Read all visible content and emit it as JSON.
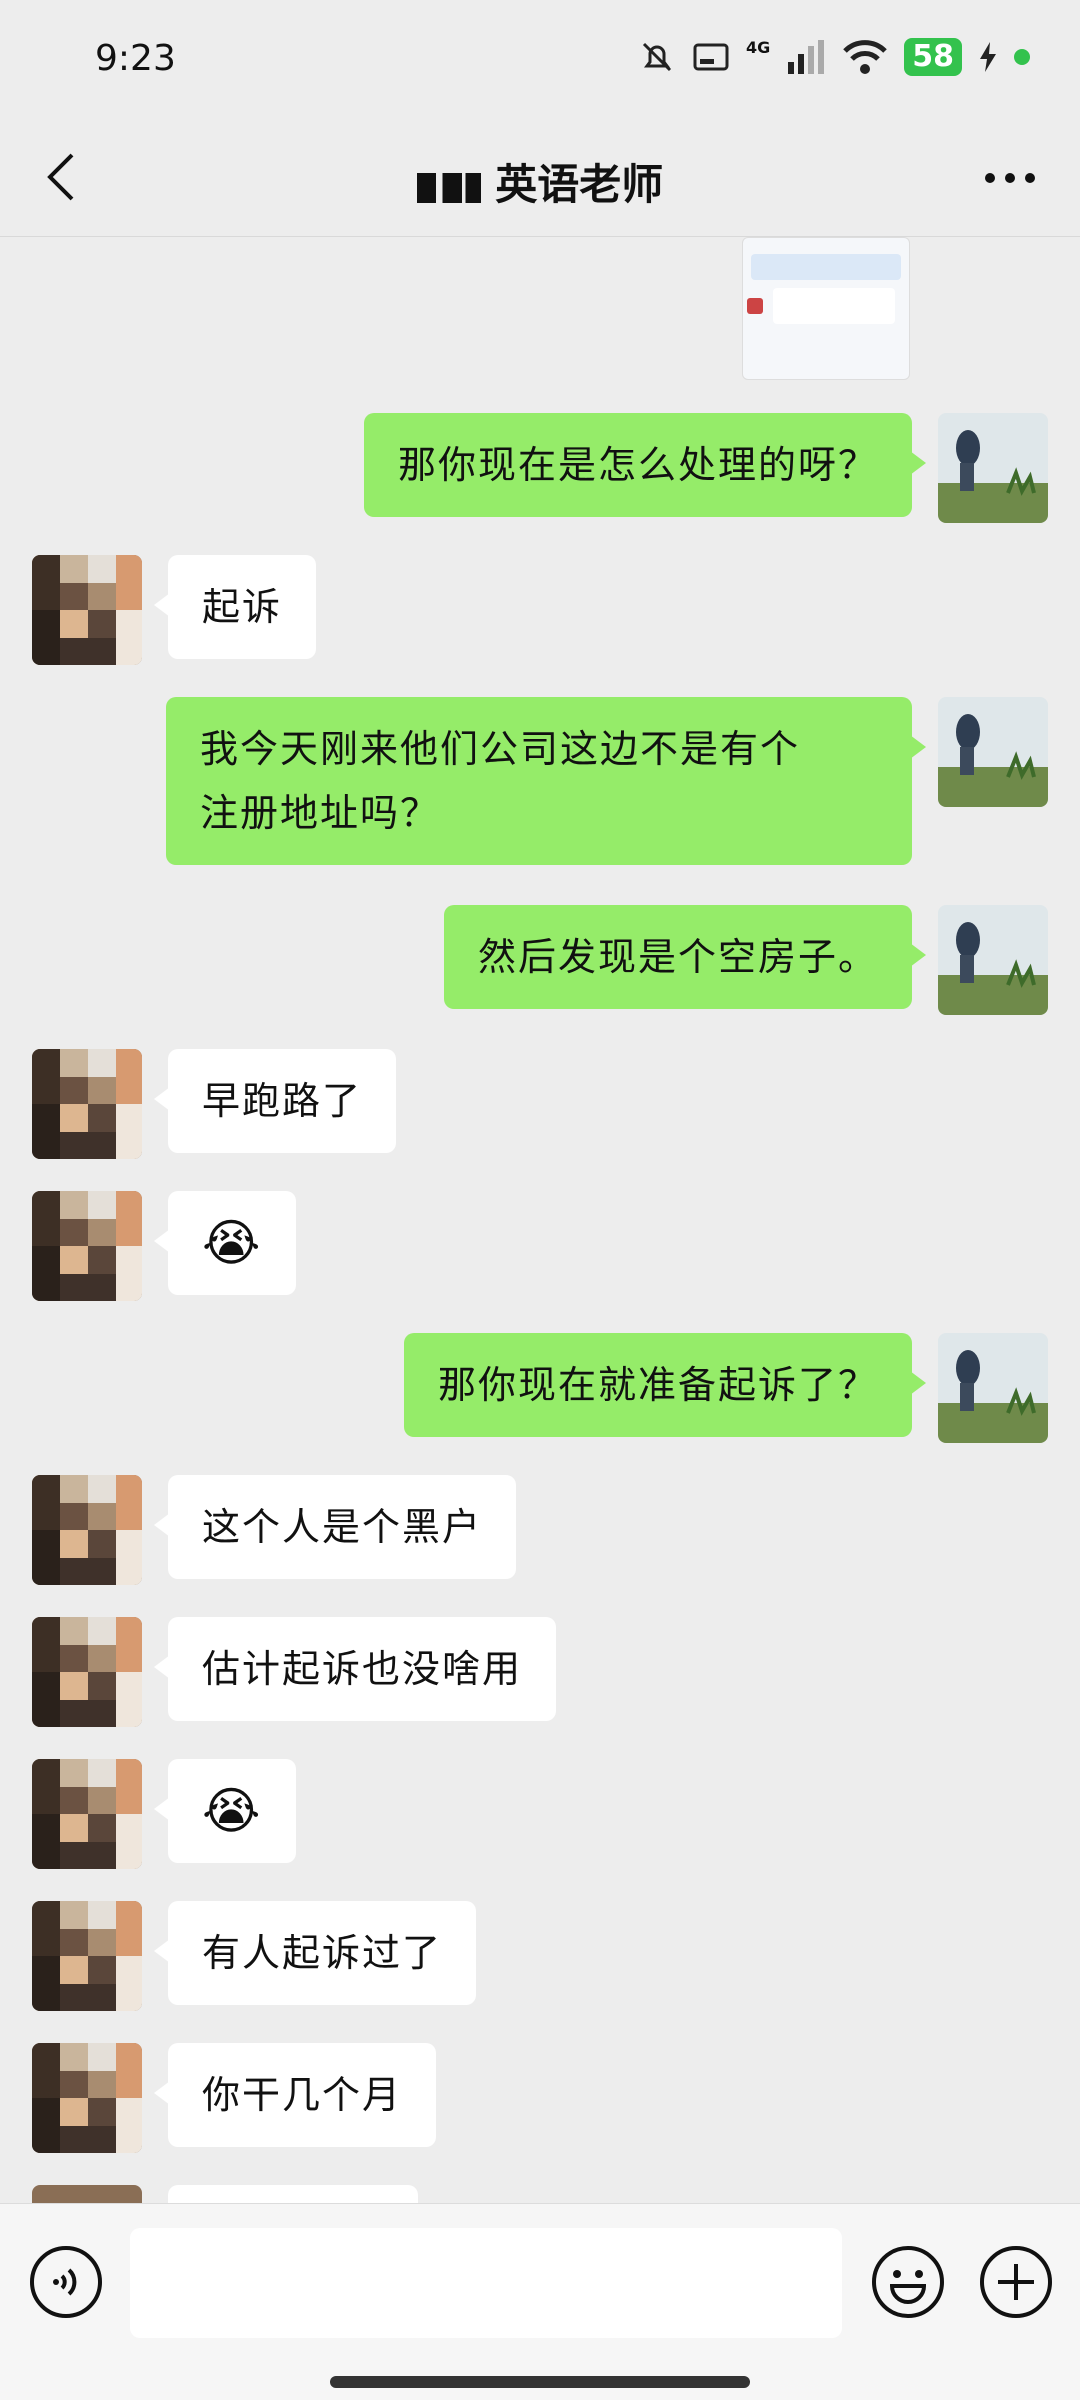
{
  "status_bar": {
    "time": "9:23",
    "battery": "58",
    "network": "4G"
  },
  "header": {
    "title": "英语老师"
  },
  "messages": [
    {
      "from": "me",
      "type": "image"
    },
    {
      "from": "me",
      "text": "那你现在是怎么处理的呀？"
    },
    {
      "from": "them",
      "text": "起诉"
    },
    {
      "from": "me",
      "text": "我今天刚来他们公司这边不是有个",
      "text2": "注册地址吗？"
    },
    {
      "from": "me",
      "text": "然后发现是个空房子。"
    },
    {
      "from": "them",
      "text": "早跑路了"
    },
    {
      "from": "them",
      "text": "😭"
    },
    {
      "from": "me",
      "text": "那你现在就准备起诉了？"
    },
    {
      "from": "them",
      "text": "这个人是个黑户"
    },
    {
      "from": "them",
      "text": "估计起诉也没啥用"
    },
    {
      "from": "them",
      "text": "😭"
    },
    {
      "from": "them",
      "text": "有人起诉过了"
    },
    {
      "from": "them",
      "text": "你干几个月"
    }
  ],
  "icons": {
    "back": "back-arrow-icon",
    "more": "more-dots-icon",
    "voice": "voice-icon",
    "emoji": "emoji-icon",
    "add": "plus-icon"
  },
  "colors": {
    "me_bubble": "#95ec69",
    "them_bubble": "#ffffff",
    "background": "#ededed"
  }
}
